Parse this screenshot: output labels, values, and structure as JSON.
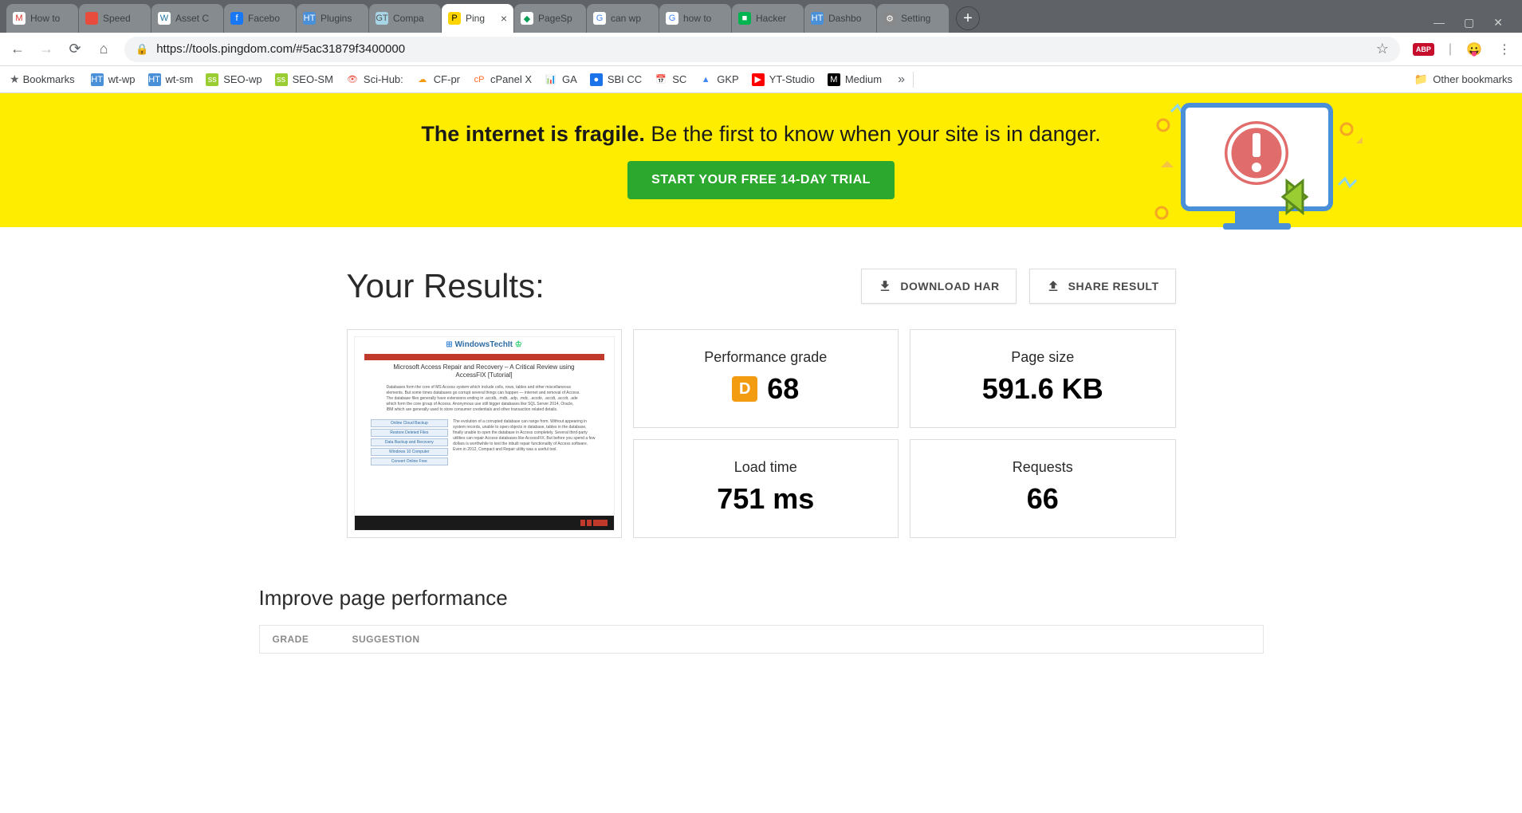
{
  "tabs": [
    {
      "favicon_bg": "#fff",
      "favicon_txt": "M",
      "favicon_color": "#d93025",
      "title": "How to"
    },
    {
      "favicon_bg": "#e74c3c",
      "favicon_txt": "",
      "favicon_color": "#fff",
      "title": "Speed"
    },
    {
      "favicon_bg": "#fff",
      "favicon_txt": "W",
      "favicon_color": "#21759b",
      "title": "Asset C"
    },
    {
      "favicon_bg": "#1877f2",
      "favicon_txt": "f",
      "favicon_color": "#fff",
      "title": "Facebo"
    },
    {
      "favicon_bg": "#4a90d9",
      "favicon_txt": "HT",
      "favicon_color": "#fff",
      "title": "Plugins"
    },
    {
      "favicon_bg": "#a8d5e5",
      "favicon_txt": "GT",
      "favicon_color": "#555",
      "title": "Compa"
    },
    {
      "favicon_bg": "#ffd500",
      "favicon_txt": "P",
      "favicon_color": "#000",
      "title": "Ping",
      "active": true,
      "closable": true
    },
    {
      "favicon_bg": "#fff",
      "favicon_txt": "◆",
      "favicon_color": "#0c9d58",
      "title": "PageSp"
    },
    {
      "favicon_bg": "#fff",
      "favicon_txt": "G",
      "favicon_color": "#4285f4",
      "title": "can wp"
    },
    {
      "favicon_bg": "#fff",
      "favicon_txt": "G",
      "favicon_color": "#4285f4",
      "title": "how to"
    },
    {
      "favicon_bg": "#00b44f",
      "favicon_txt": "■",
      "favicon_color": "#fff",
      "title": "Hacker"
    },
    {
      "favicon_bg": "#4a90d9",
      "favicon_txt": "HT",
      "favicon_color": "#fff",
      "title": "Dashbo"
    },
    {
      "favicon_bg": "#888",
      "favicon_txt": "⚙",
      "favicon_color": "#fff",
      "title": "Setting"
    }
  ],
  "url": "https://tools.pingdom.com/#5ac31879f3400000",
  "bookmarks": [
    {
      "icon_bg": "#4a90d9",
      "icon_txt": "HT",
      "icon_color": "#fff",
      "label": "wt-wp"
    },
    {
      "icon_bg": "#4a90d9",
      "icon_txt": "HT",
      "icon_color": "#fff",
      "label": "wt-sm"
    },
    {
      "icon_bg": "#9acd32",
      "icon_txt": "ss",
      "icon_color": "#fff",
      "label": "SEO-wp"
    },
    {
      "icon_bg": "#9acd32",
      "icon_txt": "ss",
      "icon_color": "#fff",
      "label": "SEO-SM"
    },
    {
      "icon_bg": "#fff",
      "icon_txt": "👁",
      "icon_color": "#e74c3c",
      "label": "Sci-Hub:"
    },
    {
      "icon_bg": "#fff",
      "icon_txt": "☁",
      "icon_color": "#f39c12",
      "label": "CF-pr"
    },
    {
      "icon_bg": "#fff",
      "icon_txt": "cP",
      "icon_color": "#ff6c2c",
      "label": "cPanel X"
    },
    {
      "icon_bg": "#fff",
      "icon_txt": "📊",
      "icon_color": "#f39c12",
      "label": "GA"
    },
    {
      "icon_bg": "#1a73e8",
      "icon_txt": "●",
      "icon_color": "#fff",
      "label": "SBI CC"
    },
    {
      "icon_bg": "#fff",
      "icon_txt": "📅",
      "icon_color": "#4285f4",
      "label": "SC"
    },
    {
      "icon_bg": "#fff",
      "icon_txt": "▲",
      "icon_color": "#4285f4",
      "label": "GKP"
    },
    {
      "icon_bg": "#ff0000",
      "icon_txt": "▶",
      "icon_color": "#fff",
      "label": "YT-Studio"
    },
    {
      "icon_bg": "#000",
      "icon_txt": "M",
      "icon_color": "#fff",
      "label": "Medium"
    }
  ],
  "bookmarks_label": "Bookmarks",
  "other_bookmarks": "Other bookmarks",
  "banner": {
    "headline_bold": "The internet is fragile.",
    "headline_rest": " Be the first to know when your site is in danger.",
    "cta": "START YOUR FREE 14-DAY TRIAL"
  },
  "results": {
    "title": "Your Results:",
    "download_btn": "DOWNLOAD HAR",
    "share_btn": "SHARE RESULT",
    "preview_site": "WindowsTechIt",
    "preview_article": "Microsoft Access Repair and Recovery – A Critical Review using AccessFIX [Tutorial]",
    "metrics": {
      "perf_label": "Performance grade",
      "perf_grade": "D",
      "perf_value": "68",
      "size_label": "Page size",
      "size_value": "591.6 KB",
      "load_label": "Load time",
      "load_value": "751 ms",
      "req_label": "Requests",
      "req_value": "66"
    }
  },
  "improve": {
    "title": "Improve page performance",
    "col_grade": "GRADE",
    "col_suggestion": "SUGGESTION"
  }
}
